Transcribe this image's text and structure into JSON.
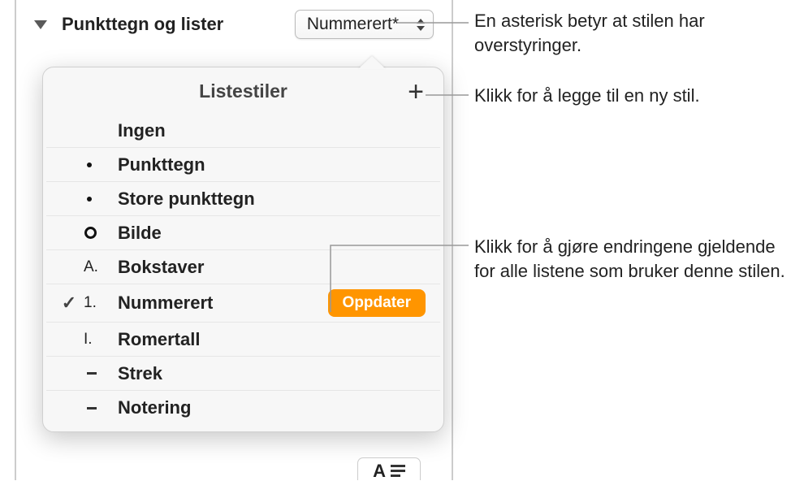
{
  "section": {
    "title": "Punkttegn og lister"
  },
  "dropdown": {
    "label": "Nummerert*"
  },
  "popover": {
    "title": "Listestiler",
    "items": [
      {
        "bullet_type": "none",
        "name": "Ingen",
        "checked": false
      },
      {
        "bullet_type": "dot",
        "name": "Punkttegn",
        "checked": false
      },
      {
        "bullet_type": "dot",
        "name": "Store punkttegn",
        "checked": false
      },
      {
        "bullet_type": "circle",
        "name": "Bilde",
        "checked": false
      },
      {
        "bullet_type": "letter",
        "marker": "A.",
        "name": "Bokstaver",
        "checked": false
      },
      {
        "bullet_type": "number",
        "marker": "1.",
        "name": "Nummerert",
        "checked": true,
        "has_update": true
      },
      {
        "bullet_type": "roman",
        "marker": "I.",
        "name": "Romertall",
        "checked": false
      },
      {
        "bullet_type": "dash",
        "name": "Strek",
        "checked": false
      },
      {
        "bullet_type": "dash",
        "name": "Notering",
        "checked": false
      }
    ],
    "update_label": "Oppdater"
  },
  "callouts": {
    "asterisk": "En asterisk betyr at stilen har overstyringer.",
    "add": "Klikk for å legge til en ny stil.",
    "update": "Klikk for å gjøre endringene gjeldende for alle listene som bruker denne stilen."
  }
}
